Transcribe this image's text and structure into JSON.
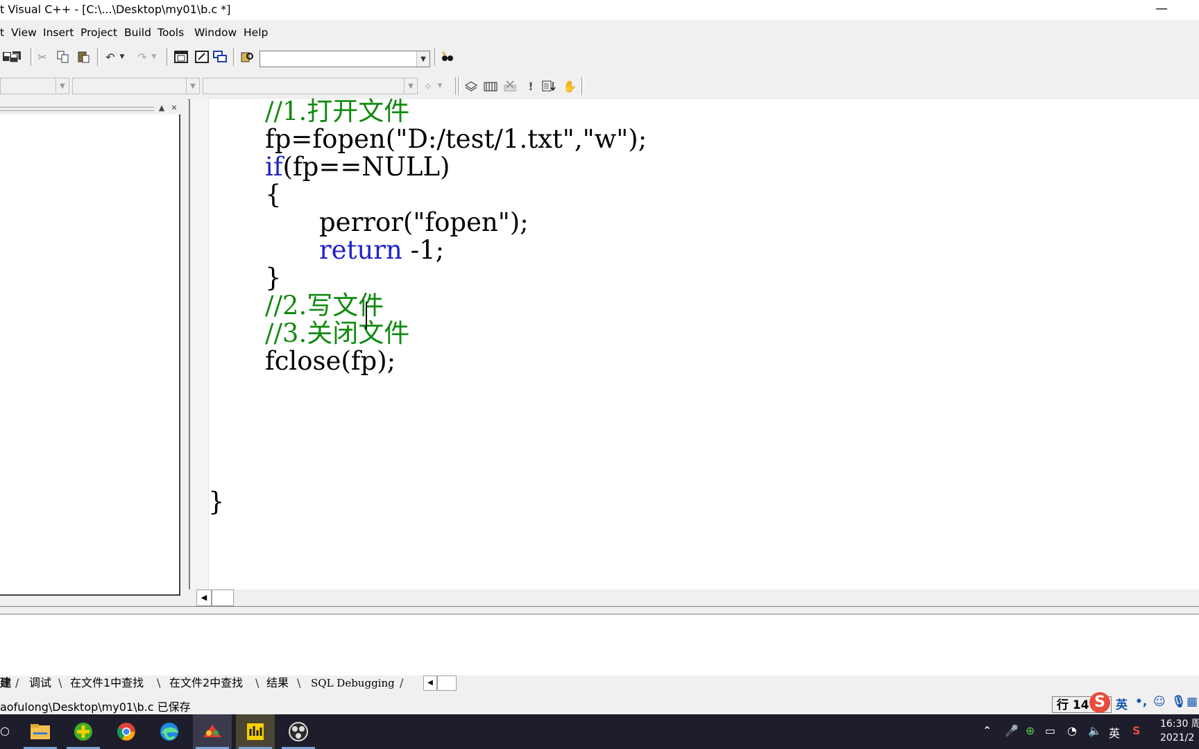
{
  "window": {
    "title": "t Visual C++ - [C:\\...\\Desktop\\my01\\b.c *]",
    "minimize_glyph": "—"
  },
  "menu": [
    "t",
    "View",
    "Insert",
    "Project",
    "Build",
    "Tools",
    "Window",
    "Help"
  ],
  "toolbar": {
    "find_combo_value": "",
    "icons": [
      "save-all-icon",
      "cut-icon",
      "copy-icon",
      "paste-icon",
      "undo-icon",
      "redo-icon",
      "workspace-icon",
      "output-icon",
      "windows-icon",
      "find-in-files-icon",
      "find-icon",
      "compile-icon",
      "build-icon",
      "stop-build-icon",
      "execute-icon",
      "go-icon",
      "breakpoint-icon"
    ]
  },
  "code": {
    "lines": [
      {
        "type": "comment",
        "text": "//1.打开文件"
      },
      {
        "type": "plain",
        "text": "fp=fopen(\"D:/test/1.txt\",\"w\");"
      },
      {
        "type": "if",
        "kw": "if",
        "rest": "(fp==NULL)"
      },
      {
        "type": "plain",
        "text": "{"
      },
      {
        "type": "plain",
        "text": "perror(\"fopen\");"
      },
      {
        "type": "return",
        "kw": "return",
        "rest": " -1;"
      },
      {
        "type": "plain",
        "text": "}"
      },
      {
        "type": "comment",
        "text": "//2.写文件"
      },
      {
        "type": "comment",
        "text": "//3.关闭文件"
      },
      {
        "type": "plain",
        "text": "fclose(fp);"
      },
      {
        "type": "plain",
        "text": "}"
      }
    ]
  },
  "output_tabs": [
    "建",
    "调试",
    "在文件1中查找",
    "在文件2中查找",
    "结果",
    "SQL Debugging"
  ],
  "status": {
    "message": "aofulong\\Desktop\\my01\\b.c 已保存",
    "line_col": "行 14"
  },
  "ime": {
    "logo": "S",
    "lang": "英",
    "punct": "•,"
  },
  "taskbar": {
    "apps": [
      "file-explorer",
      "360-browser",
      "chrome",
      "edge",
      "paint-app",
      "vc-app",
      "obs-app"
    ],
    "tray_lang": "英",
    "time": "16:30 周",
    "date": "2021/2"
  }
}
